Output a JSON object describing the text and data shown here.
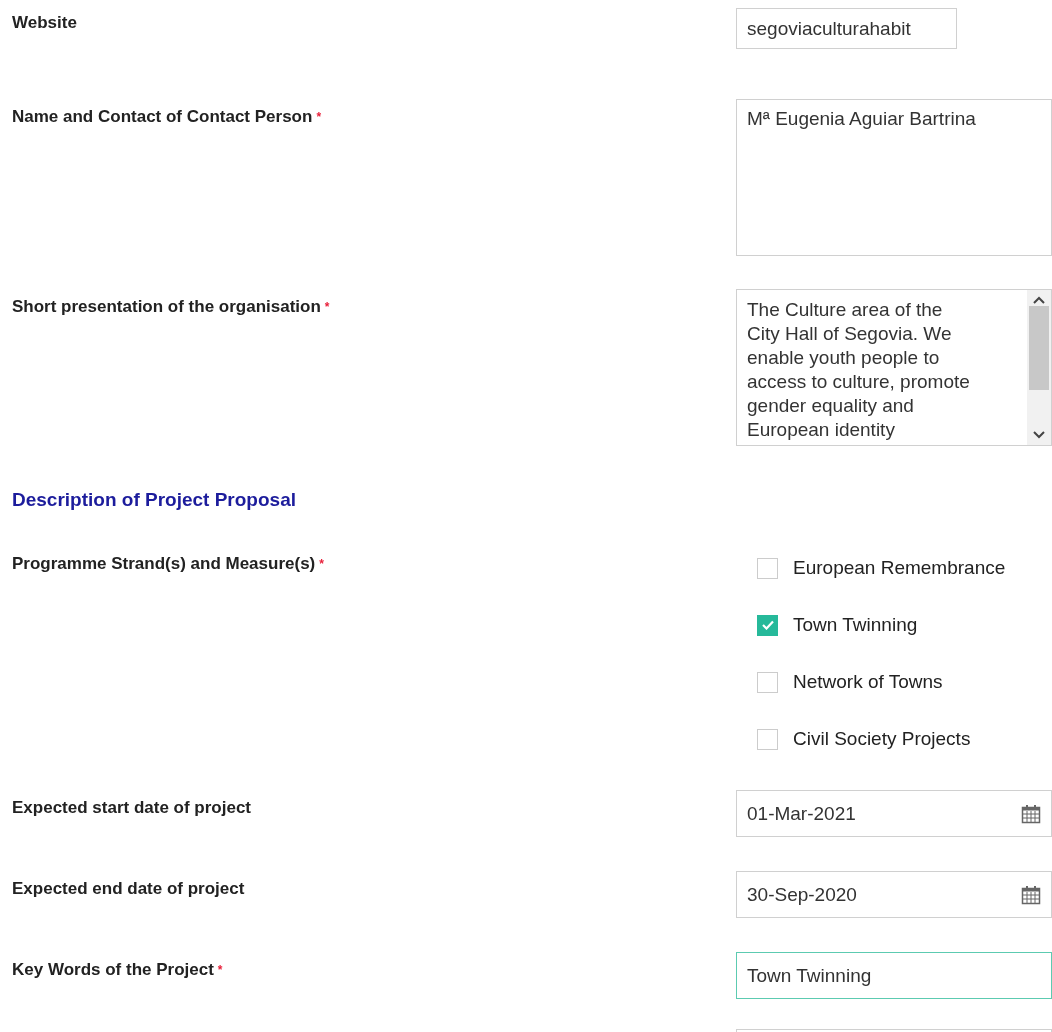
{
  "items": [
    {
      "kind": "url",
      "label": "Website",
      "value": "segoviaculturahabit"
    },
    {
      "kind": "textarea",
      "label": "Name and Contact of Contact Person",
      "required_mark": "*",
      "value": "Mª Eugenia Aguiar Bartrina"
    },
    {
      "kind": "scrolltext",
      "label": "Short presentation of the organisation",
      "required_mark": "*",
      "value": "The Culture area of the City Hall of Segovia. We enable youth people to access to culture, promote gender equality and European identity"
    },
    {
      "kind": "heading",
      "label": "Description of Project Proposal"
    },
    {
      "kind": "checkboxes",
      "label": "Programme Strand(s) and Measure(s)",
      "required_mark": "*",
      "options": [
        {
          "label": "European Remembrance",
          "checked": false
        },
        {
          "label": "Town Twinning",
          "checked": true
        },
        {
          "label": "Network of Towns",
          "checked": false
        },
        {
          "label": "Civil Society Projects",
          "checked": false
        }
      ]
    },
    {
      "kind": "date",
      "label": "Expected start date of project",
      "value": "01-Mar-2021"
    },
    {
      "kind": "date",
      "label": "Expected end date of project",
      "value": "30-Sep-2020"
    },
    {
      "kind": "text",
      "label": "Key Words of the Project",
      "required_mark": "*",
      "value": "Town Twinning",
      "focused": true
    },
    {
      "kind": "text"
    }
  ]
}
